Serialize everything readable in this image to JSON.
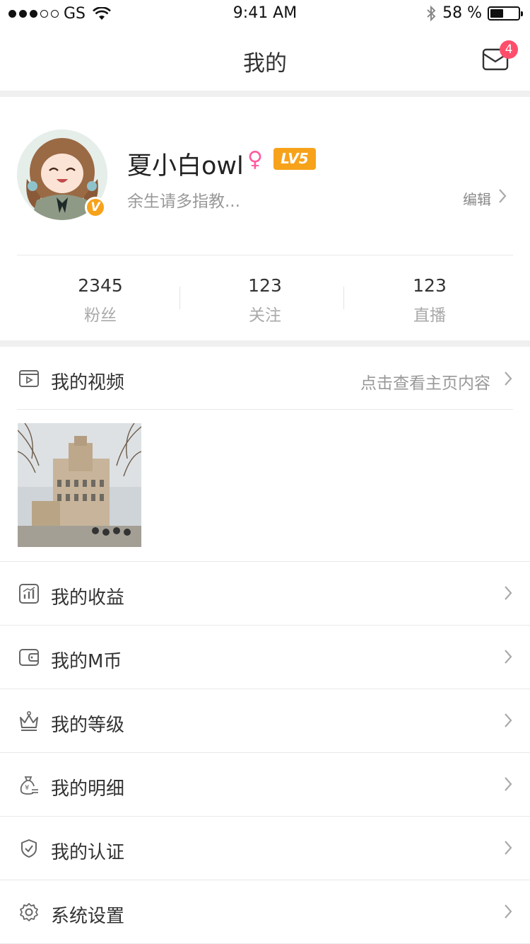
{
  "status_bar": {
    "carrier": "GS",
    "time": "9:41 AM",
    "battery": "58 %"
  },
  "nav": {
    "title": "我的",
    "unread_count": "4"
  },
  "profile": {
    "username": "夏小白owl",
    "gender_symbol": "♀",
    "level": "LV5",
    "bio": "余生请多指教...",
    "edit_label": "编辑",
    "verified_mark": "V"
  },
  "stats": [
    {
      "value": "2345",
      "label": "粉丝"
    },
    {
      "value": "123",
      "label": "关注"
    },
    {
      "value": "123",
      "label": "直播"
    }
  ],
  "videos": {
    "label": "我的视频",
    "hint": "点击查看主页内容"
  },
  "menu": [
    {
      "label": "我的收益",
      "icon": "chart-icon"
    },
    {
      "label": "我的M币",
      "icon": "wallet-icon"
    },
    {
      "label": "我的等级",
      "icon": "crown-icon"
    },
    {
      "label": "我的明细",
      "icon": "money-bag-icon"
    },
    {
      "label": "我的认证",
      "icon": "shield-check-icon"
    },
    {
      "label": "系统设置",
      "icon": "gear-icon"
    }
  ],
  "colors": {
    "accent_pink": "#ff4e6a",
    "level_orange": "#f7a21b",
    "separator": "#f0f0f0"
  }
}
